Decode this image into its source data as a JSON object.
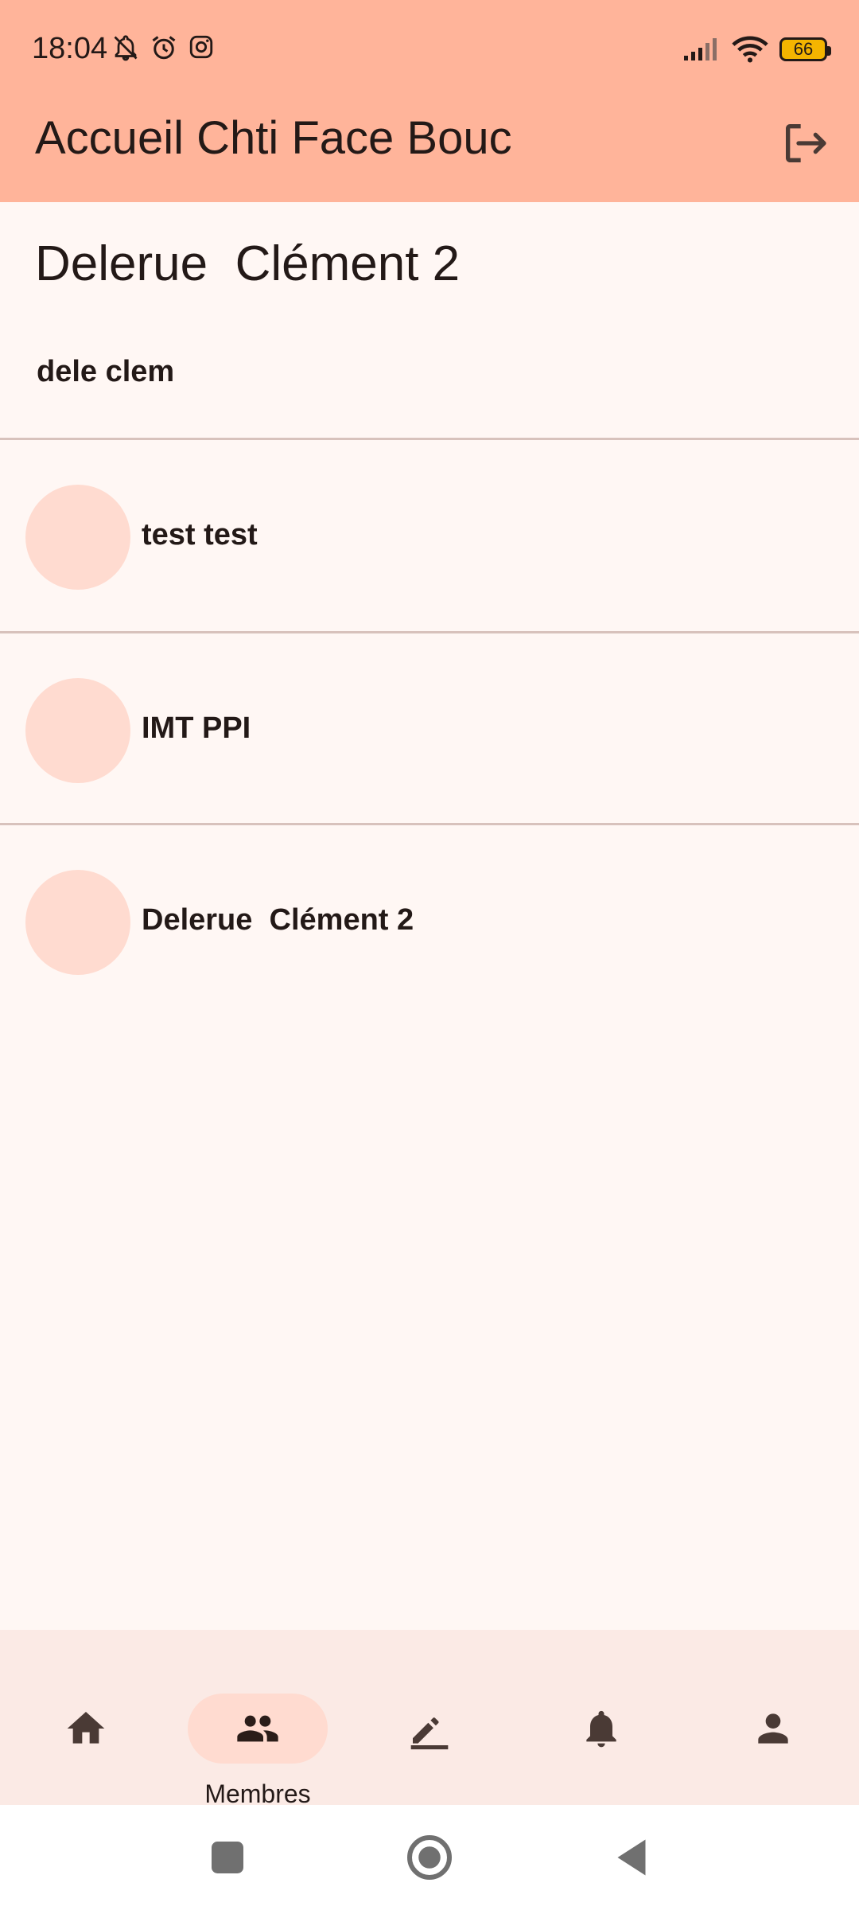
{
  "status_bar": {
    "time": "18:04",
    "battery": "66"
  },
  "app_bar": {
    "title": "Accueil Chti Face Bouc"
  },
  "profile": {
    "name": "Delerue  Clément 2",
    "username": "dele clem"
  },
  "members": [
    {
      "name": "test test"
    },
    {
      "name": "IMT PPI"
    },
    {
      "name": "Delerue  Clément 2"
    }
  ],
  "bottom_nav": {
    "items": [
      {
        "icon": "home-icon",
        "label": ""
      },
      {
        "icon": "group-icon",
        "label": "Membres"
      },
      {
        "icon": "edit-icon",
        "label": ""
      },
      {
        "icon": "bell-icon",
        "label": ""
      },
      {
        "icon": "person-icon",
        "label": ""
      }
    ],
    "selected_index": 1
  },
  "colors": {
    "app_bar": "#FFB49A",
    "background": "#FFF7F4",
    "avatar": "#FFDBD0",
    "nav_bar": "#FBEAE5",
    "nav_indicator": "#FFDBD0"
  }
}
